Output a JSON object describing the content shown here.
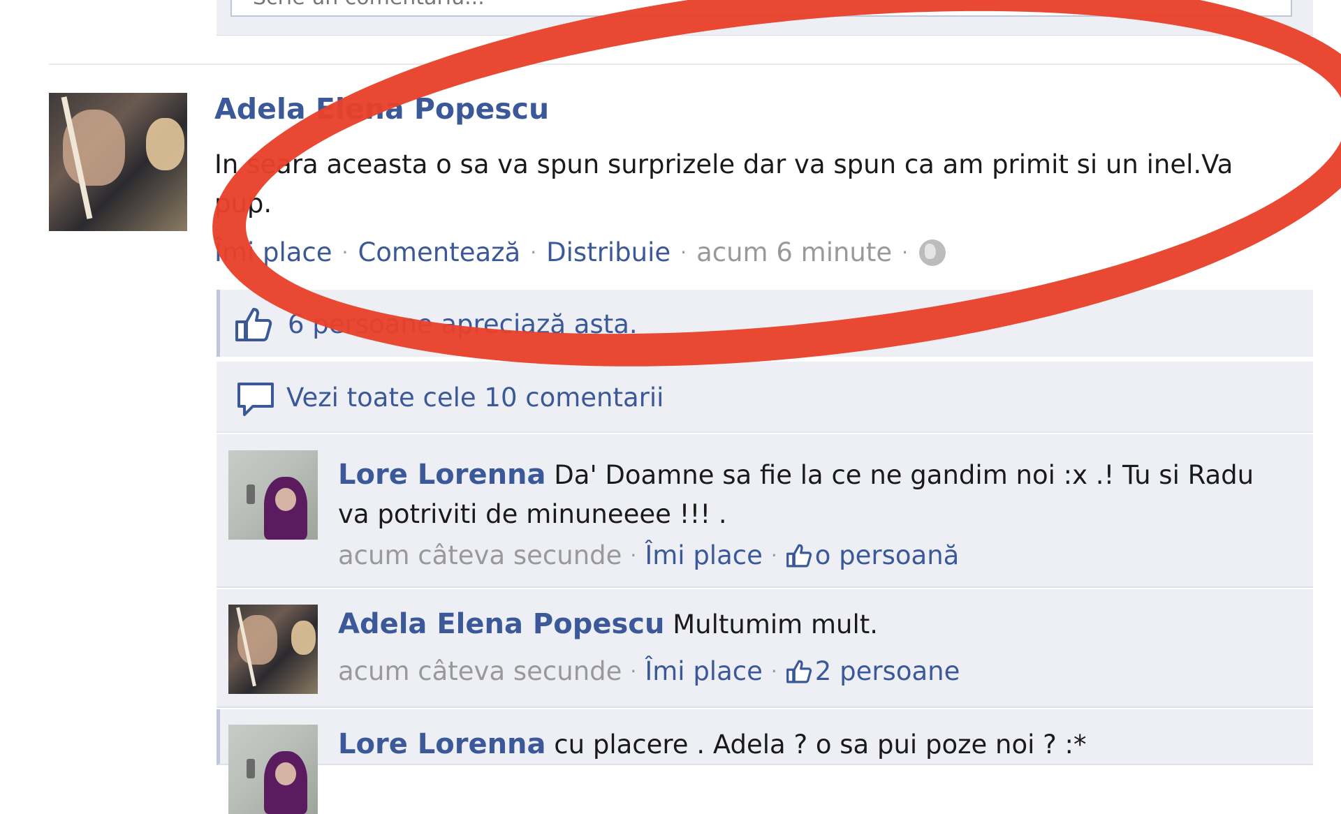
{
  "composer": {
    "placeholder": "Scrie un comentariu..."
  },
  "post": {
    "author": "Adela Elena Popescu",
    "text": "In seara aceasta o sa va spun surprizele dar va spun ca am primit si un inel.Va pup.",
    "actions": {
      "like": "Îmi place",
      "comment": "Comentează",
      "share": "Distribuie"
    },
    "time": "acum 6 minute",
    "privacy_icon": "globe-icon"
  },
  "likes": {
    "text": "6 persoane apreciază asta."
  },
  "comments_link": {
    "text": "Vezi toate cele 10 comentarii"
  },
  "comments": [
    {
      "author": "Lore Lorenna",
      "text": "Da' Doamne sa fie la ce ne gandim noi :x .! Tu si Radu va potriviti de minuneeee !!! .",
      "time": "acum câteva secunde",
      "like_label": "Îmi place",
      "likes_count": "o persoană"
    },
    {
      "author": "Adela Elena Popescu",
      "text": "Multumim mult.",
      "time": "acum câteva secunde",
      "like_label": "Îmi place",
      "likes_count": "2 persoane"
    },
    {
      "author": "Lore Lorenna",
      "text": "cu placere . Adela ? o sa pui poze noi ? :*"
    }
  ],
  "annotation": {
    "color": "#e8412b"
  },
  "colors": {
    "link": "#3b5998",
    "ufi_bg": "#edeff4",
    "meta": "#999999"
  }
}
